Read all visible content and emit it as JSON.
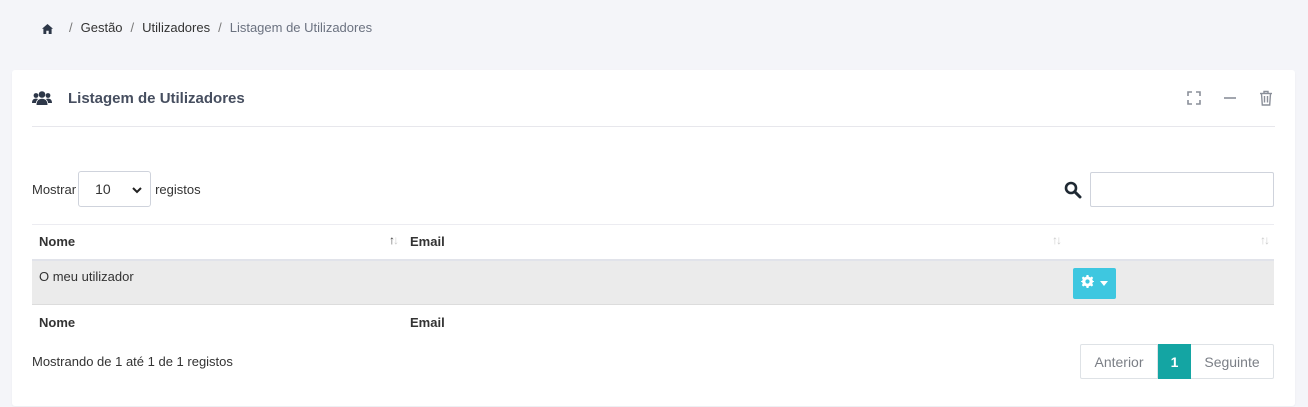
{
  "breadcrumb": {
    "items": [
      "Gestão",
      "Utilizadores"
    ],
    "current": "Listagem de Utilizadores",
    "separator": "/"
  },
  "card": {
    "title": "Listagem de Utilizadores",
    "icon": "users-icon",
    "tools": [
      "expand-icon",
      "minimize-icon",
      "trash-icon"
    ]
  },
  "table_controls": {
    "show_label": "Mostrar",
    "page_length": "10",
    "records_label": "registos",
    "search_value": "",
    "search_placeholder": ""
  },
  "table": {
    "columns": [
      "Nome",
      "Email",
      ""
    ],
    "rows": [
      {
        "nome": "O meu utilizador",
        "email": ""
      }
    ],
    "footer_columns": [
      "Nome",
      "Email",
      ""
    ]
  },
  "info": "Mostrando de 1 até 1 de 1 registos",
  "pagination": {
    "prev": "Anterior",
    "pages": [
      "1"
    ],
    "current": "1",
    "next": "Seguinte"
  },
  "colors": {
    "accent": "#14a5a3",
    "action_button": "#3ec7e0",
    "background": "#f4f5f9"
  }
}
